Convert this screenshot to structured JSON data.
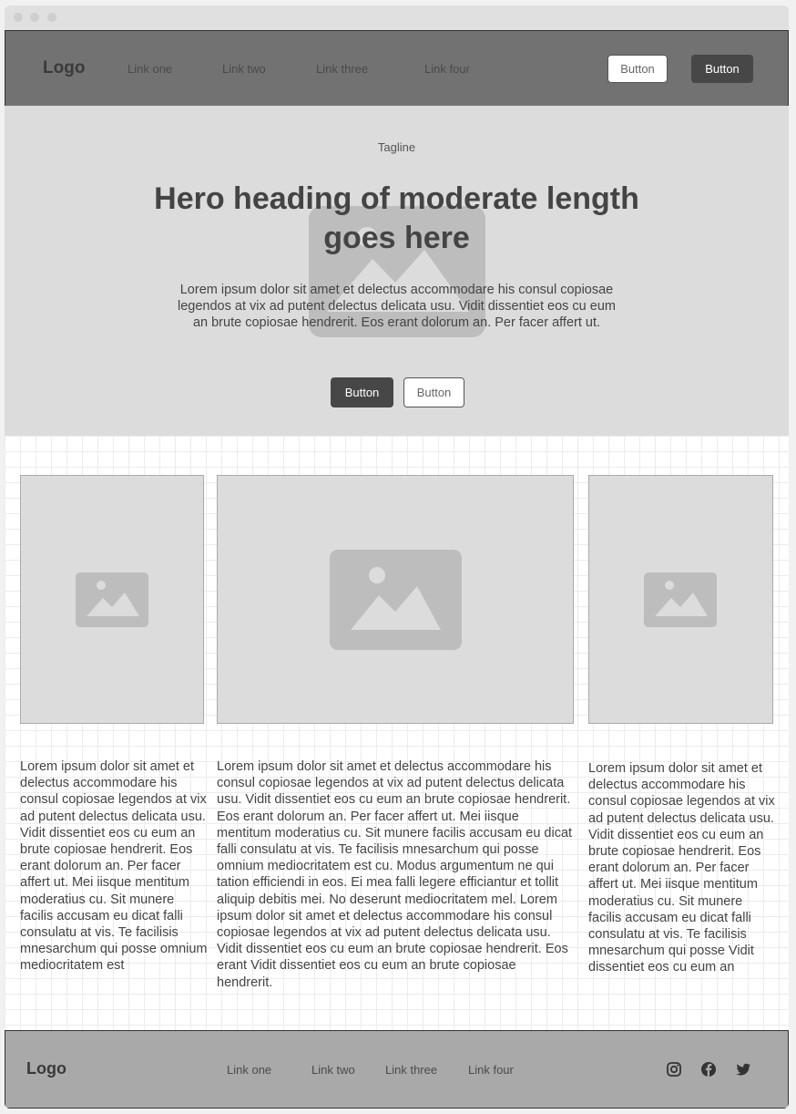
{
  "navbar": {
    "logo": "Logo",
    "links": [
      "Link one",
      "Link two",
      "Link three",
      "Link four"
    ],
    "button_secondary": "Button",
    "button_primary": "Button"
  },
  "hero": {
    "tagline": "Tagline",
    "heading": "Hero heading of moderate length goes here",
    "text": "Lorem ipsum dolor sit amet et delectus accommodare his consul copiosae legendos at vix ad putent delectus delicata usu. Vidit dissentiet eos cu eum an brute copiosae hendrerit. Eos erant dolorum an. Per facer affert ut.",
    "button_primary": "Button",
    "button_secondary": "Button"
  },
  "columns": [
    {
      "text": "Lorem ipsum dolor sit amet et delectus accommodare his consul copiosae legendos at vix ad putent delectus delicata usu. Vidit dissentiet eos cu eum an brute copiosae hendrerit. Eos erant dolorum an. Per facer affert ut. Mei iisque mentitum moderatius cu. Sit munere facilis accusam eu dicat falli consulatu at vis. Te facilisis mnesarchum qui posse omnium mediocritatem est"
    },
    {
      "text": "Lorem ipsum dolor sit amet et delectus accommodare his consul copiosae legendos at vix ad putent delectus delicata usu. Vidit dissentiet eos cu eum an brute copiosae hendrerit. Eos erant dolorum an. Per facer affert ut. Mei iisque mentitum moderatius cu. Sit munere facilis accusam eu dicat falli consulatu at vis. Te facilisis mnesarchum qui posse omnium mediocritatem est cu. Modus argumentum ne qui tation efficiendi in eos. Ei mea falli legere efficiantur et tollit aliquip debitis mei. No deserunt mediocritatem mel. Lorem ipsum dolor sit amet et delectus accommodare his consul copiosae legendos at vix ad putent delectus delicata usu. Vidit dissentiet eos cu eum an brute copiosae hendrerit. Eos erant Vidit dissentiet eos cu eum an brute copiosae hendrerit."
    },
    {
      "text": "Lorem ipsum dolor sit amet et delectus accommodare his consul copiosae legendos at vix ad putent delectus delicata usu. Vidit dissentiet eos cu eum an brute copiosae hendrerit. Eos erant dolorum an. Per facer affert ut. Mei iisque mentitum moderatius cu. Sit munere facilis accusam eu dicat falli consulatu at vis. Te facilisis mnesarchum qui posse Vidit dissentiet eos cu eum an"
    }
  ],
  "footer": {
    "logo": "Logo",
    "links": [
      "Link one",
      "Link two",
      "Link three",
      "Link four"
    ],
    "social_icons": [
      "instagram-icon",
      "facebook-icon",
      "twitter-icon"
    ]
  },
  "colors": {
    "navbar_bg": "#727272",
    "hero_bg": "#dcdcdc",
    "footer_bg": "#a9a9a9",
    "primary_button": "#474747"
  }
}
